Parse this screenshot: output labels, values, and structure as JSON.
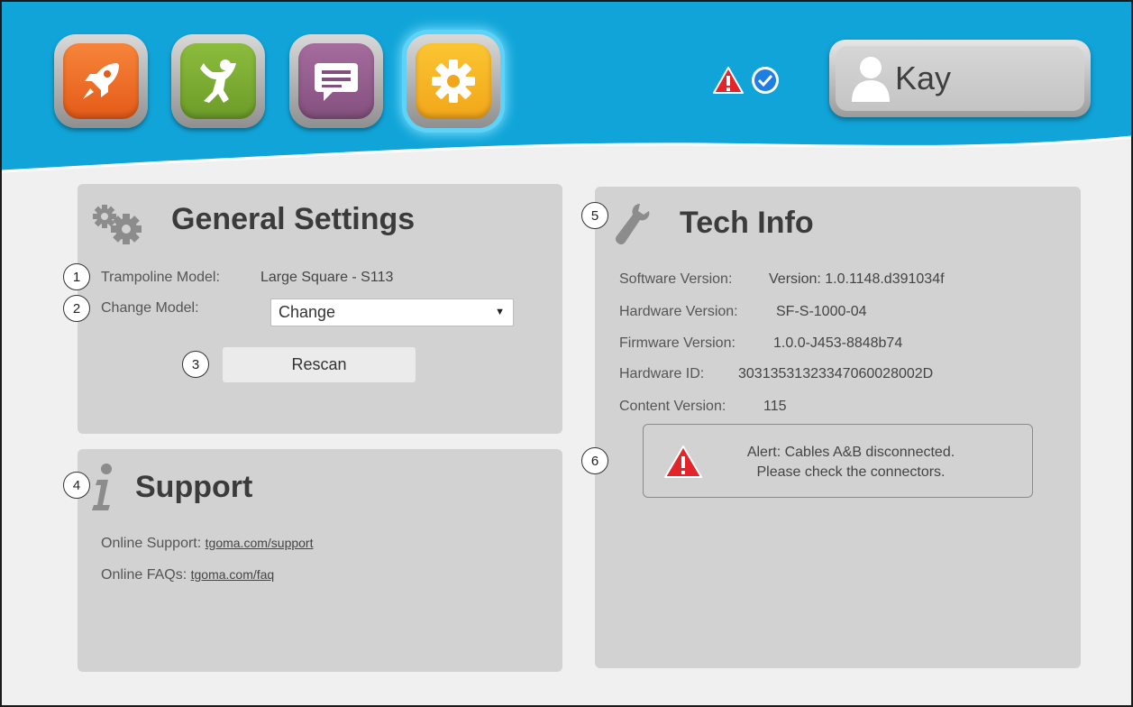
{
  "header": {
    "nav_icons": [
      "rocket-icon",
      "person-jumping-icon",
      "chat-bubble-icon",
      "gear-icon"
    ],
    "active_icon": "gear-icon",
    "status_icons": [
      "warning-icon",
      "check-circle-icon"
    ],
    "user_name": "Kay",
    "colors": {
      "header_bg": "#0fa3d6",
      "active_glow": "#5fd3f7"
    }
  },
  "general": {
    "title": "General Settings",
    "trampoline_model_label": "Trampoline Model:",
    "trampoline_model_value": "Large Square - S113",
    "change_model_label": "Change Model:",
    "change_model_selected": "Change",
    "rescan_label": "Rescan",
    "numbers": [
      "1",
      "2",
      "3"
    ]
  },
  "support": {
    "title": "Support",
    "online_support_label": "Online Support:",
    "online_support_link": "tgoma.com/support",
    "online_faqs_label": "Online FAQs:",
    "online_faqs_link": "tgoma.com/faq",
    "number": "4"
  },
  "tech": {
    "title": "Tech Info",
    "number": "5",
    "alert_number": "6",
    "rows": [
      {
        "label": "Software Version:",
        "value": "Version: 1.0.1148.d391034f"
      },
      {
        "label": "Hardware Version:",
        "value": "SF-S-1000-04"
      },
      {
        "label": "Firmware Version:",
        "value": "1.0.0-J453-8848b74"
      },
      {
        "label": "Hardware ID:",
        "value": "3031353132334706002800​2D"
      },
      {
        "label": "Content Version:",
        "value": "115"
      }
    ],
    "alert_line1": "Alert: Cables A&B disconnected.",
    "alert_line2": "Please check the connectors."
  }
}
